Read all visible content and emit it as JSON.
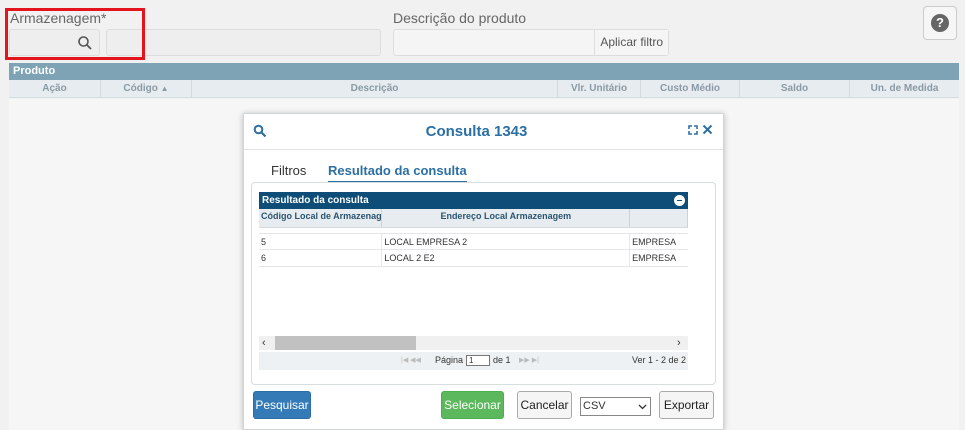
{
  "filters": {
    "storage_label": "Armazenagem*",
    "description_label": "Descrição do produto",
    "apply_filter_label": "Aplicar filtro",
    "help_label": "?"
  },
  "product_grid": {
    "title": "Produto",
    "columns": [
      "Ação",
      "Código",
      "Descrição",
      "Vlr. Unitário",
      "Custo Médio",
      "Saldo",
      "Un. de Medida"
    ]
  },
  "modal": {
    "title": "Consulta 1343",
    "tabs": [
      "Filtros",
      "Resultado da consulta"
    ],
    "results": {
      "header": "Resultado da consulta",
      "columns": [
        "Código Local de Armazenag",
        "Endereço Local Armazenagem",
        ""
      ],
      "rows": [
        [
          "5",
          "LOCAL EMPRESA 2",
          "EMPRESA"
        ],
        [
          "6",
          "LOCAL 2 E2",
          "EMPRESA"
        ]
      ]
    },
    "pager": {
      "page_label": "Página",
      "page_value": "1",
      "of_label": "de 1",
      "count_label": "Ver 1 - 2 de 2"
    },
    "buttons": {
      "search": "Pesquisar",
      "select": "Selecionar",
      "cancel": "Cancelar",
      "format": "CSV",
      "export": "Exportar"
    }
  }
}
